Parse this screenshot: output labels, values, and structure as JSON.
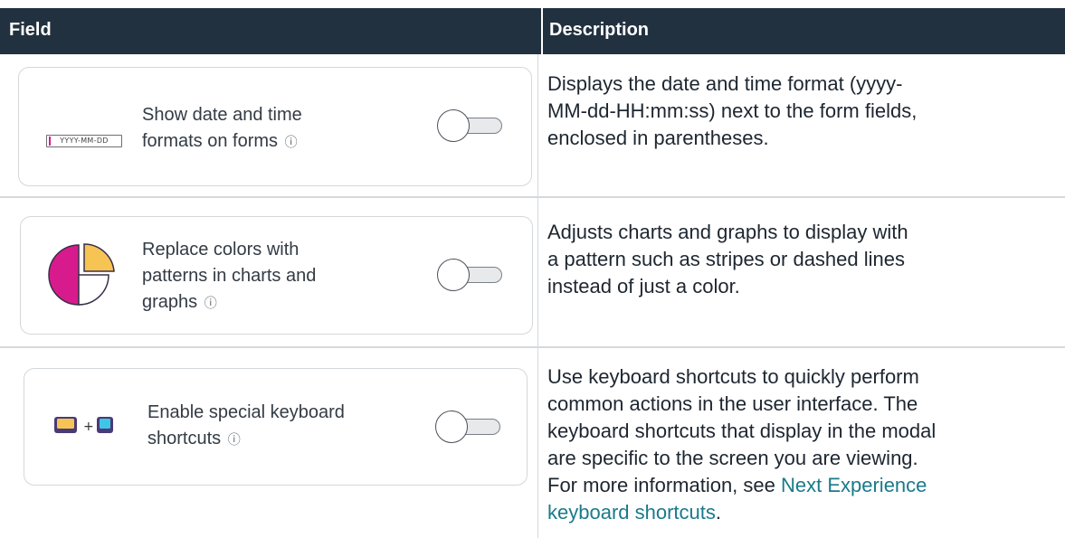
{
  "header": {
    "field": "Field",
    "description": "Description"
  },
  "rows": [
    {
      "icon": "date-format-icon",
      "icon_text": "YYYY-MM-DD",
      "label_line1": "Show date and time",
      "label_line2": "formats on forms",
      "info_icon": "ⓘ",
      "toggle_on": false,
      "desc_lines": [
        "Displays the date and time format (yyyy-",
        "MM-dd-HH:mm:ss) next to the form fields,",
        "enclosed in parentheses."
      ]
    },
    {
      "icon": "pie-chart-pattern-icon",
      "label_line1": "Replace colors with",
      "label_line2": "patterns in charts and",
      "label_line3": "graphs",
      "info_icon": "ⓘ",
      "toggle_on": false,
      "desc_lines": [
        "Adjusts charts and graphs to display with",
        "a pattern such as stripes or dashed lines",
        "instead of just a color."
      ]
    },
    {
      "icon": "keyboard-shortcut-icon",
      "label_line1": "Enable special keyboard",
      "label_line2": "shortcuts",
      "info_icon": "ⓘ",
      "toggle_on": false,
      "desc_lines": [
        "Use keyboard shortcuts to quickly perform",
        "common actions in the user interface. The",
        "keyboard shortcuts that display in the modal",
        "are specific to the screen you are viewing."
      ],
      "desc_link_prefix": "For more information, see ",
      "desc_link_line1": "Next Experience",
      "desc_link_line2": "keyboard shortcuts",
      "desc_link_suffix": "."
    }
  ],
  "colors": {
    "header_bg": "#22313f",
    "accent_magenta": "#d81b8c",
    "accent_yellow": "#f6c453",
    "accent_cyan": "#3fc6e6",
    "link": "#1a7a8a"
  }
}
